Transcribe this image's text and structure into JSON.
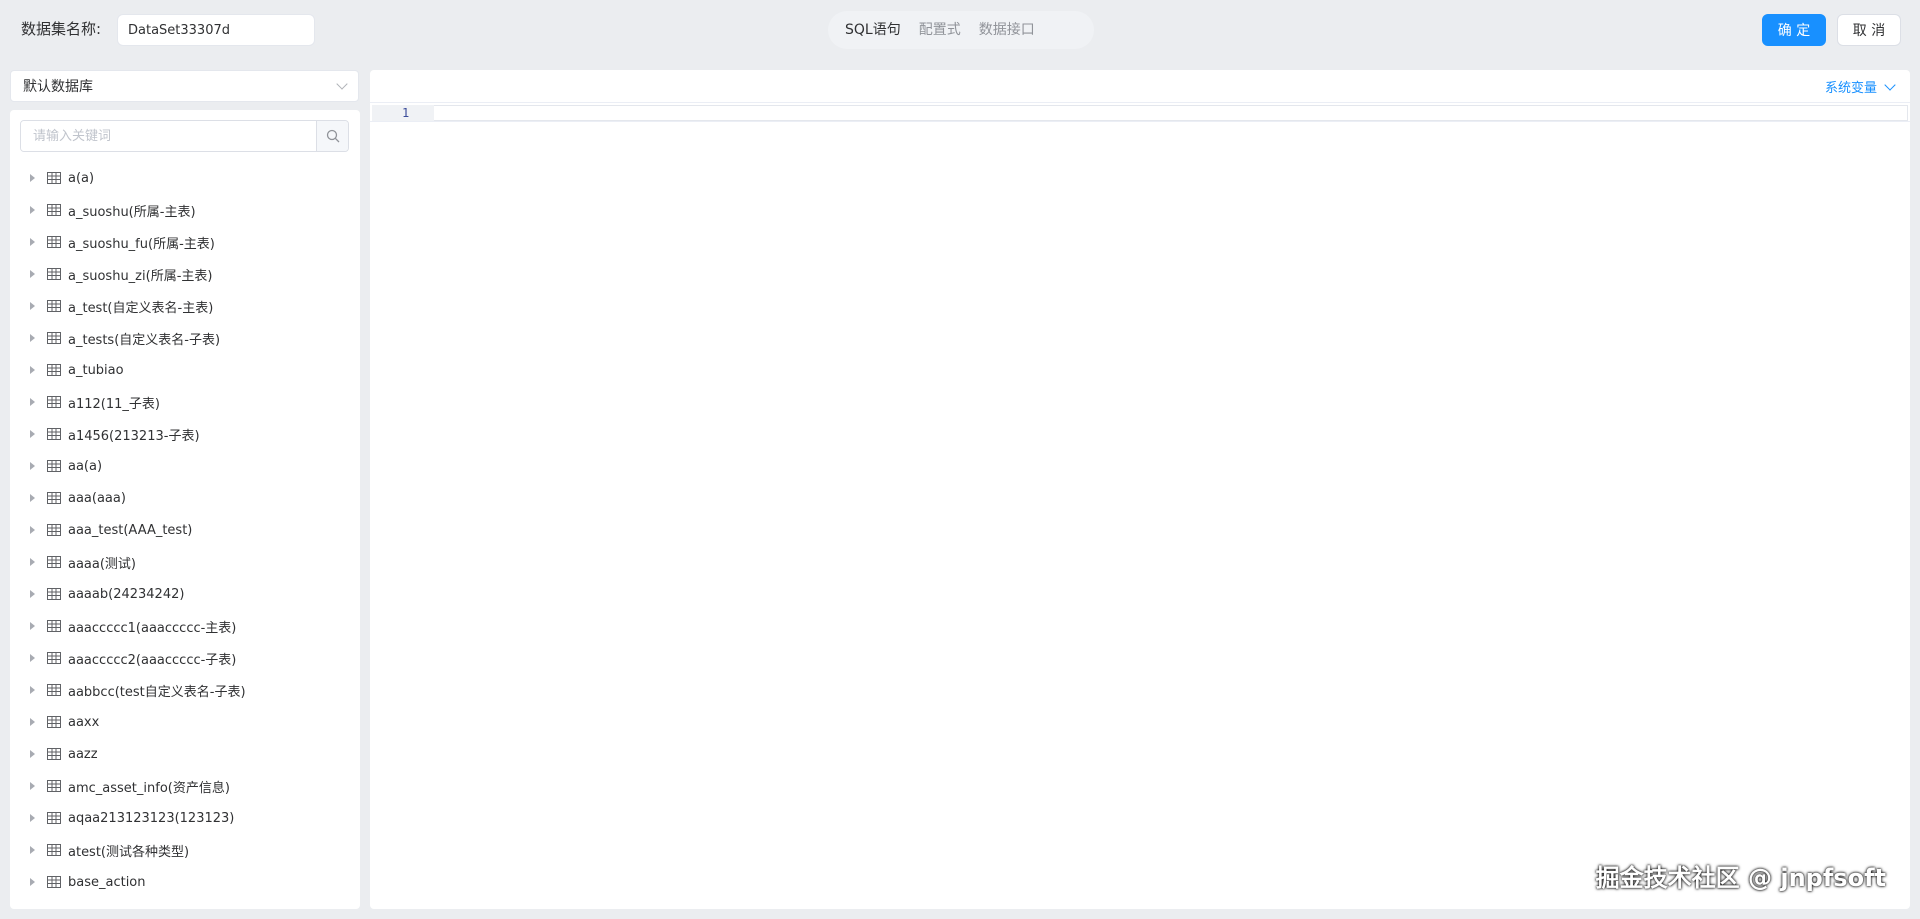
{
  "header": {
    "dataset_label": "数据集名称:",
    "dataset_name": "DataSet33307d",
    "tabs": [
      {
        "label": "SQL语句",
        "active": true
      },
      {
        "label": "配置式",
        "active": false
      },
      {
        "label": "数据接口",
        "active": false
      }
    ],
    "confirm_label": "确 定",
    "cancel_label": "取 消"
  },
  "left": {
    "db_select_value": "默认数据库",
    "search_placeholder": "请输入关键词",
    "tables": [
      "a(a)",
      "a_suoshu(所属-主表)",
      "a_suoshu_fu(所属-主表)",
      "a_suoshu_zi(所属-主表)",
      "a_test(自定义表名-主表)",
      "a_tests(自定义表名-子表)",
      "a_tubiao",
      "a112(11_子表)",
      "a1456(213213-子表)",
      "aa(a)",
      "aaa(aaa)",
      "aaa_test(AAA_test)",
      "aaaa(测试)",
      "aaaab(24234242)",
      "aaaccccc1(aaaccccc-主表)",
      "aaaccccc2(aaaccccc-子表)",
      "aabbcc(test自定义表名-子表)",
      "aaxx",
      "aazz",
      "amc_asset_info(资产信息)",
      "aqaa213123123(123123)",
      "atest(测试各种类型)",
      "base_action"
    ]
  },
  "editor": {
    "system_variables_label": "系统变量",
    "line_number": "1"
  },
  "watermark": "掘金技术社区 @ jnpfsoft",
  "colors": {
    "primary": "#1890ff",
    "background": "#ebedf0"
  }
}
